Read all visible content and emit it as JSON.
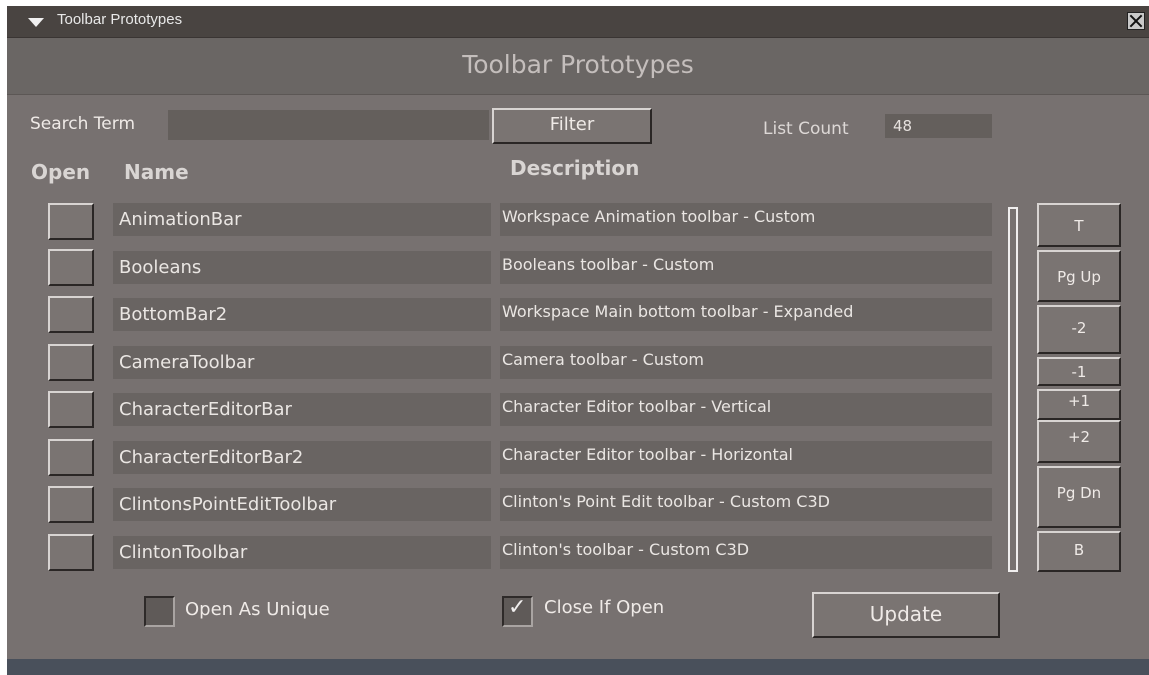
{
  "window": {
    "title": "Toolbar Prototypes",
    "header": "Toolbar Prototypes"
  },
  "search": {
    "label": "Search Term",
    "value": "",
    "filter_label": "Filter"
  },
  "count": {
    "label": "List Count",
    "value": "48"
  },
  "columns": {
    "open": "Open",
    "name": "Name",
    "description": "Description"
  },
  "rows": [
    {
      "name": "AnimationBar",
      "description": "Workspace Animation toolbar - Custom"
    },
    {
      "name": "Booleans",
      "description": "Booleans toolbar - Custom"
    },
    {
      "name": "BottomBar2",
      "description": "Workspace Main bottom toolbar - Expanded"
    },
    {
      "name": "CameraToolbar",
      "description": "Camera toolbar - Custom"
    },
    {
      "name": "CharacterEditorBar",
      "description": "Character Editor toolbar - Vertical"
    },
    {
      "name": "CharacterEditorBar2",
      "description": "Character Editor toolbar - Horizontal"
    },
    {
      "name": "ClintonsPointEditToolbar",
      "description": "Clinton's Point Edit toolbar - Custom C3D"
    },
    {
      "name": "ClintonToolbar",
      "description": "Clinton's toolbar - Custom C3D"
    }
  ],
  "nav": {
    "top": "T",
    "pgup": "Pg Up",
    "minus2": "-2",
    "minus1": "-1",
    "plus1": "+1",
    "plus2": "+2",
    "pgdn": "Pg Dn",
    "bottom": "B"
  },
  "options": {
    "open_unique": "Open As Unique",
    "open_unique_checked": false,
    "close_if_open": "Close If Open",
    "close_if_open_checked": true
  },
  "update_label": "Update"
}
